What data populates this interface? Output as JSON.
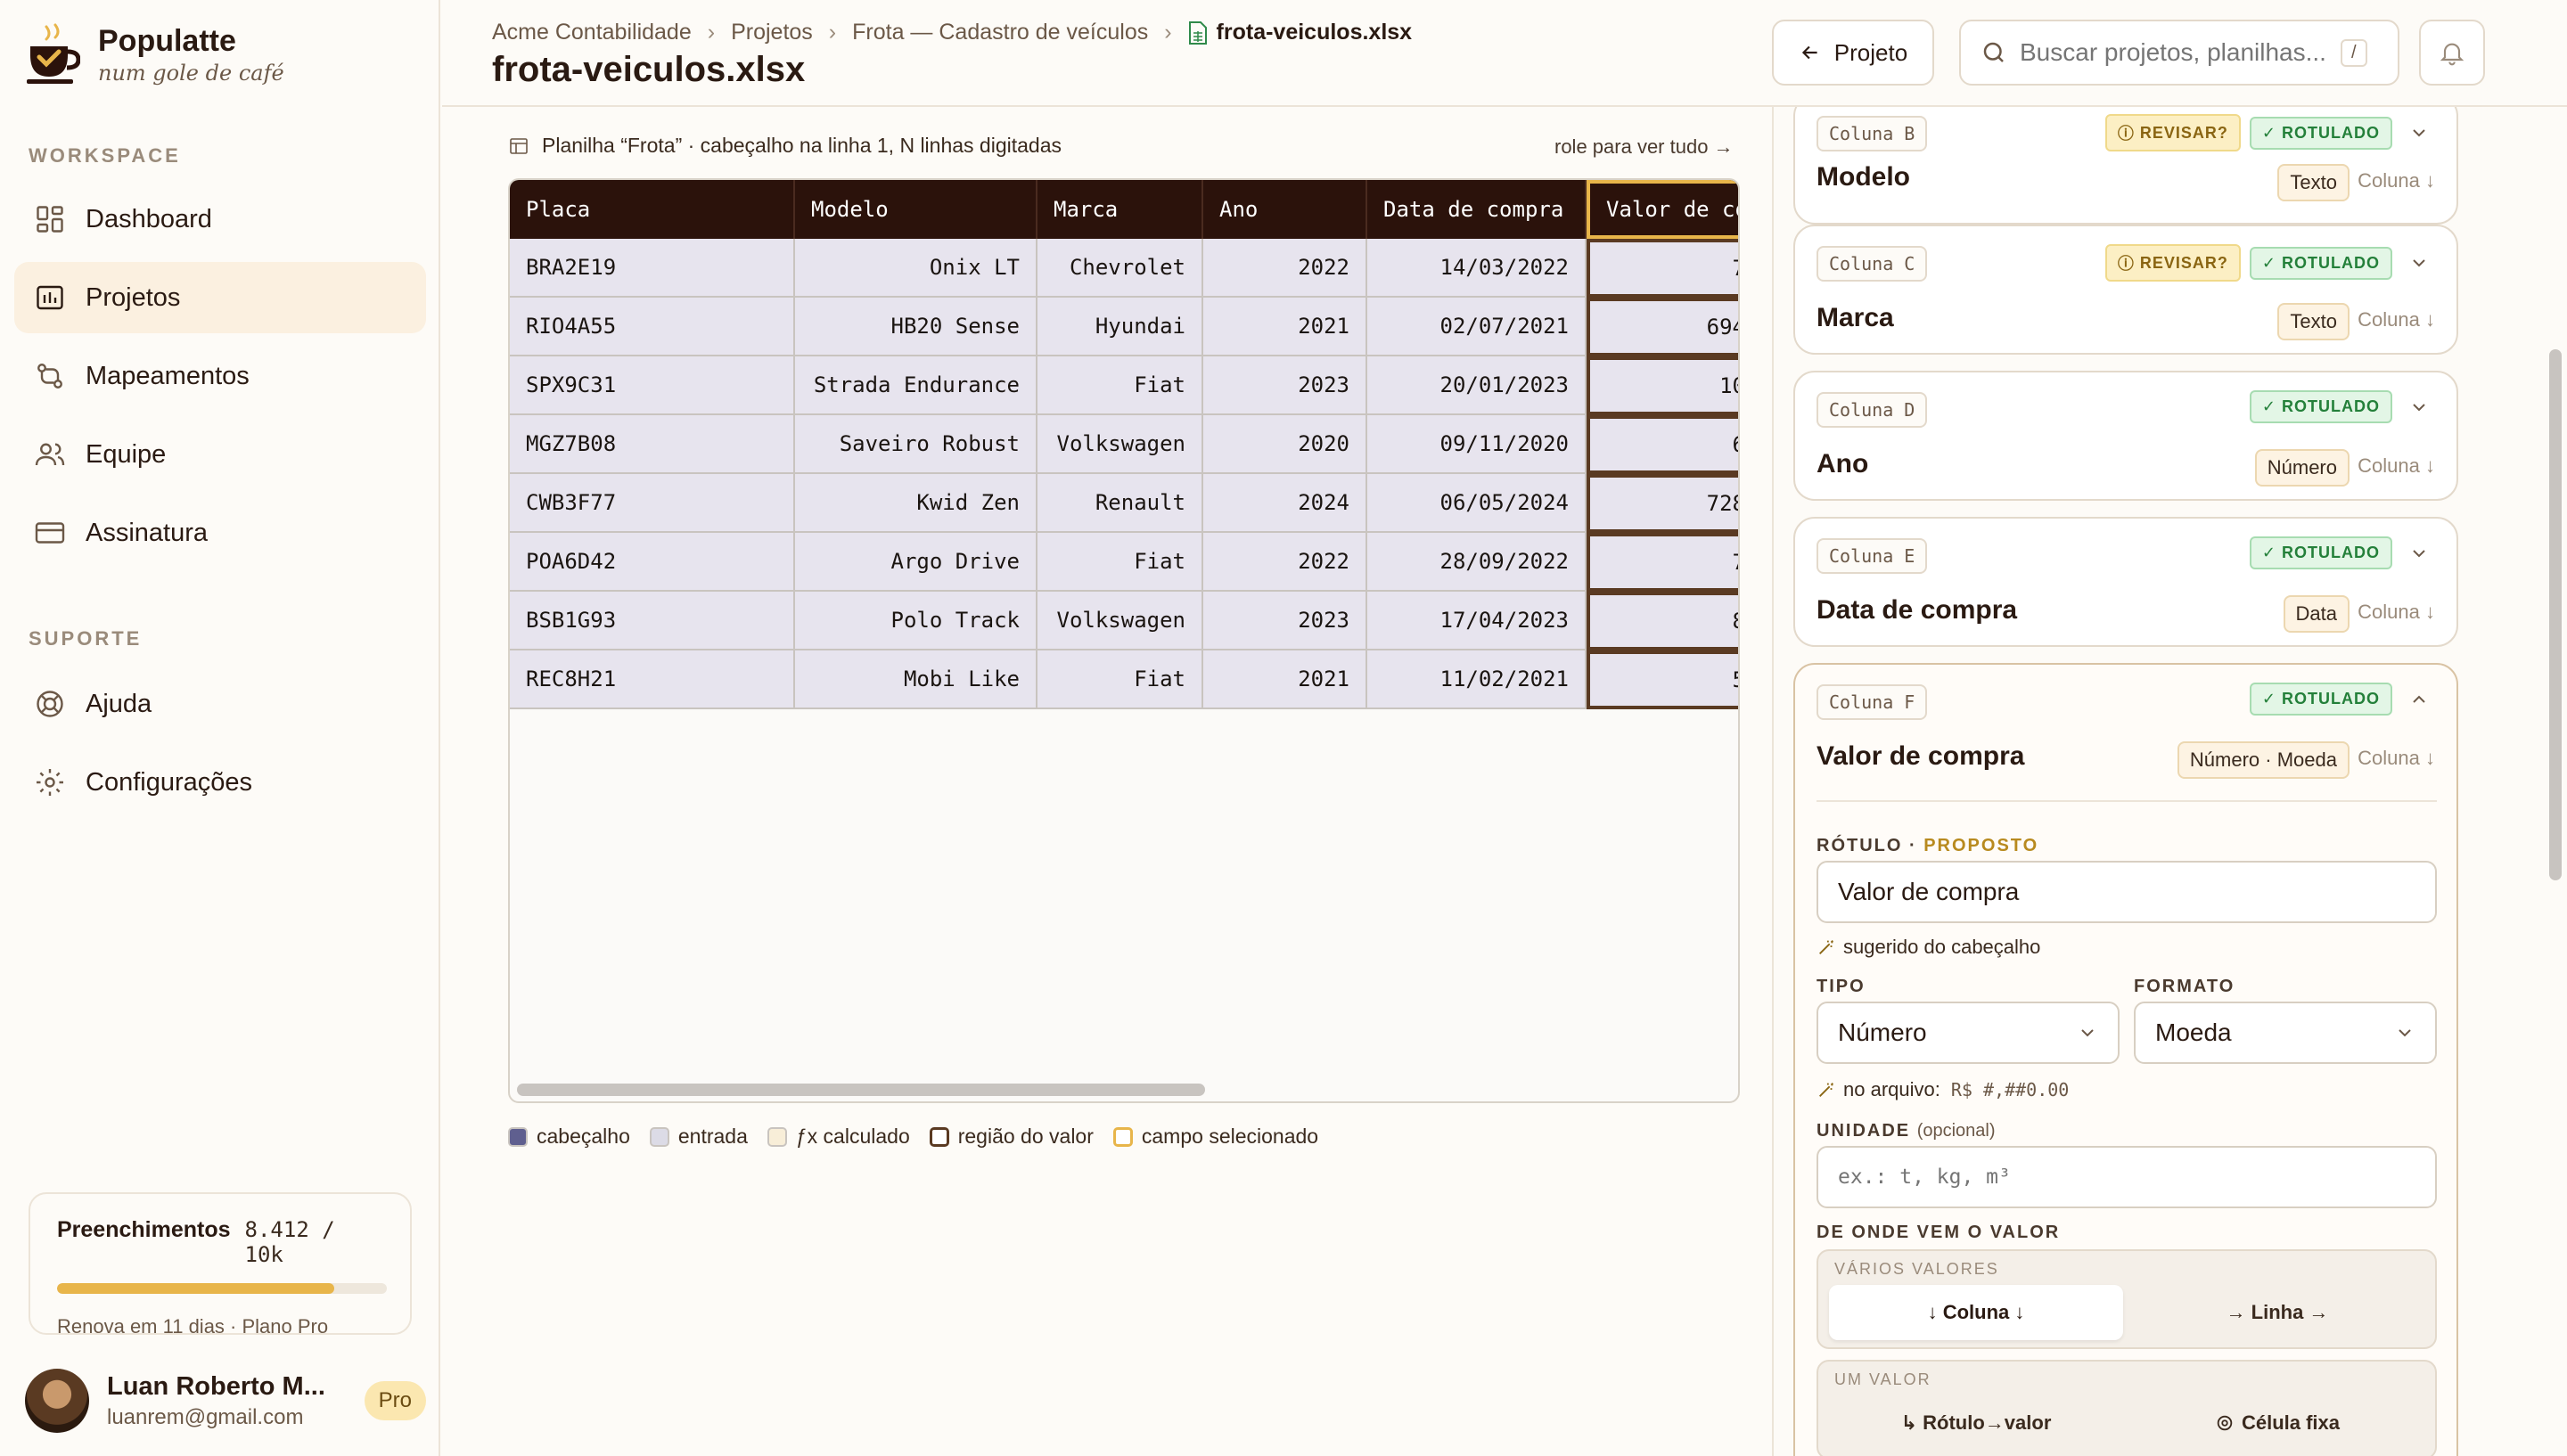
{
  "brand": {
    "name": "Populatte",
    "tagline": "num gole de café"
  },
  "sidebar": {
    "workspace_label": "WORKSPACE",
    "support_label": "SUPORTE",
    "items": [
      {
        "label": "Dashboard",
        "icon": "dashboard-icon"
      },
      {
        "label": "Projetos",
        "icon": "projects-icon",
        "active": true
      },
      {
        "label": "Mapeamentos",
        "icon": "mappings-icon"
      },
      {
        "label": "Equipe",
        "icon": "team-icon"
      },
      {
        "label": "Assinatura",
        "icon": "billing-icon"
      }
    ],
    "support_items": [
      {
        "label": "Ajuda",
        "icon": "help-icon"
      },
      {
        "label": "Configurações",
        "icon": "gear-icon"
      }
    ],
    "usage": {
      "label": "Preenchimentos",
      "count": "8.412 / 10k",
      "progress": 0.8412,
      "renew": "Renova em 11 dias · Plano Pro"
    },
    "user": {
      "name": "Luan Roberto M...",
      "email": "luanrem@gmail.com",
      "plan": "Pro"
    }
  },
  "header": {
    "breadcrumbs": [
      "Acme Contabilidade",
      "Projetos",
      "Frota — Cadastro de veículos",
      "frota-veiculos.xlsx"
    ],
    "title": "frota-veiculos.xlsx",
    "back_label": "Projeto",
    "search_placeholder": "Buscar projetos, planilhas...",
    "search_shortcut": "/"
  },
  "sheet": {
    "caption": "Planilha “Frota” · cabeçalho na linha 1, N linhas digitadas",
    "scroll_hint": "role para ver tudo →",
    "columns": [
      "Placa",
      "Modelo",
      "Marca",
      "Ano",
      "Data de compra",
      "Valor de co"
    ],
    "rows": [
      [
        "BRA2E19",
        "Onix LT",
        "Chevrolet",
        "2022",
        "14/03/2022",
        "7"
      ],
      [
        "RIO4A55",
        "HB20 Sense",
        "Hyundai",
        "2021",
        "02/07/2021",
        "694"
      ],
      [
        "SPX9C31",
        "Strada Endurance",
        "Fiat",
        "2023",
        "20/01/2023",
        "10"
      ],
      [
        "MGZ7B08",
        "Saveiro Robust",
        "Volkswagen",
        "2020",
        "09/11/2020",
        "6"
      ],
      [
        "CWB3F77",
        "Kwid Zen",
        "Renault",
        "2024",
        "06/05/2024",
        "728"
      ],
      [
        "POA6D42",
        "Argo Drive",
        "Fiat",
        "2022",
        "28/09/2022",
        "7"
      ],
      [
        "BSB1G93",
        "Polo Track",
        "Volkswagen",
        "2023",
        "17/04/2023",
        "8"
      ],
      [
        "REC8H21",
        "Mobi Like",
        "Fiat",
        "2021",
        "11/02/2021",
        "5"
      ]
    ],
    "legend": [
      {
        "label": "cabeçalho",
        "color": "#5f5f8f"
      },
      {
        "label": "entrada",
        "color": "#dcdbe6"
      },
      {
        "label": "ƒx calculado",
        "color": "#f8eed8"
      },
      {
        "label": "região do valor",
        "color": "#5a3a22"
      },
      {
        "label": "campo selecionado",
        "color": "#e8b54a"
      }
    ]
  },
  "panel": {
    "cards": [
      {
        "column": "Coluna B",
        "title": "Modelo",
        "type": "Texto",
        "orientation": "Coluna ↓",
        "review": "REVISAR?",
        "status": "ROTULADO"
      },
      {
        "column": "Coluna C",
        "title": "Marca",
        "type": "Texto",
        "orientation": "Coluna ↓",
        "review": "REVISAR?",
        "status": "ROTULADO"
      },
      {
        "column": "Coluna D",
        "title": "Ano",
        "type": "Número",
        "orientation": "Coluna ↓",
        "status": "ROTULADO"
      },
      {
        "column": "Coluna E",
        "title": "Data de compra",
        "type": "Data",
        "orientation": "Coluna ↓",
        "status": "ROTULADO"
      }
    ],
    "open_card": {
      "column": "Coluna F",
      "title": "Valor de compra",
      "type": "Número · Moeda",
      "orientation": "Coluna ↓",
      "status": "ROTULADO",
      "label_title": "RÓTULO",
      "label_state": "PROPOSTO",
      "label_value": "Valor de compra",
      "label_hint": "sugerido do cabeçalho",
      "type_label": "TIPO",
      "type_value": "Número",
      "format_label": "FORMATO",
      "format_value": "Moeda",
      "file_hint": "no arquivo:",
      "file_format": "R$ #,##0.00",
      "unit_label": "UNIDADE",
      "unit_optional": "(opcional)",
      "unit_placeholder": "ex.: t, kg, m³",
      "source_label": "DE ONDE VEM O VALOR",
      "multi_label": "VÁRIOS VALORES",
      "multi_options": [
        "↓ Coluna ↓",
        "→ Linha →"
      ],
      "single_label": "UM VALOR",
      "single_options": [
        "↳ Rótulo→valor",
        "Célula fixa"
      ]
    }
  }
}
